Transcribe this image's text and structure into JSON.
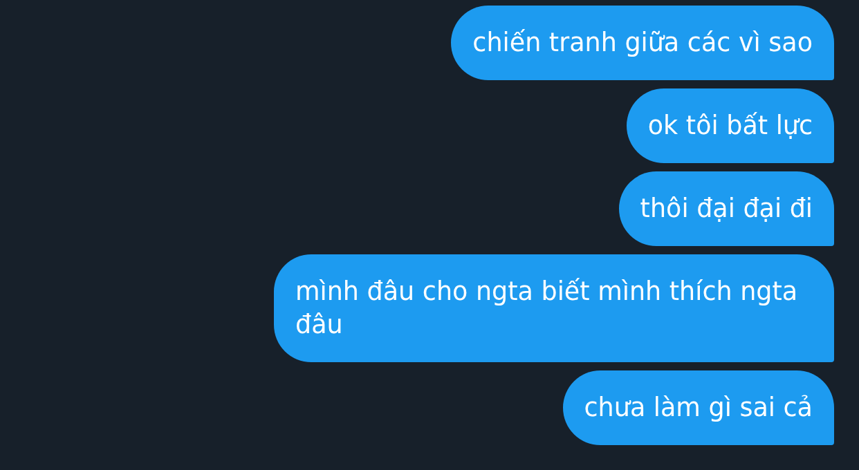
{
  "messages": [
    {
      "text": "chiến tranh giữa các vì sao"
    },
    {
      "text": "ok tôi bất lực"
    },
    {
      "text": "thôi đại đại đi"
    },
    {
      "text": "mình đâu cho ngta biết mình thích ngta đâu"
    },
    {
      "text": "chưa làm gì sai cả"
    }
  ]
}
